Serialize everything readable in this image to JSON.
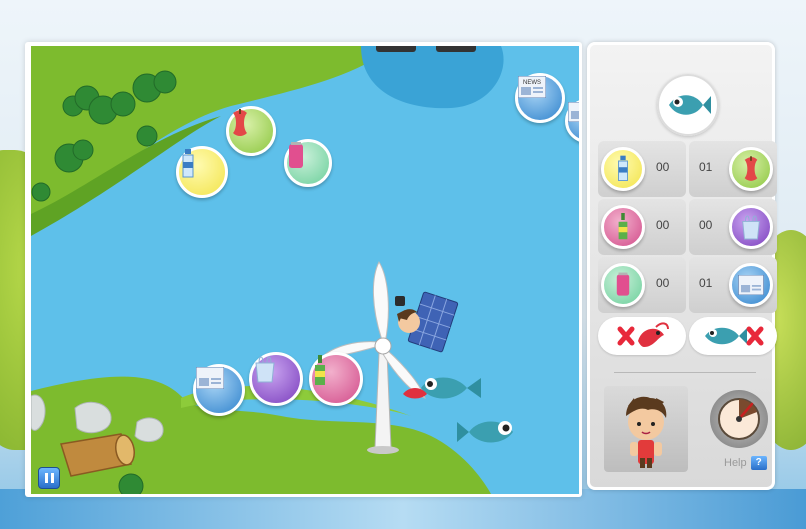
{
  "panel": {
    "rows": [
      {
        "left_count": "00",
        "right_count": "01",
        "left_item": "water-bottle-icon",
        "right_item": "apple-core-icon"
      },
      {
        "left_count": "00",
        "right_count": "00",
        "left_item": "glass-bottle-icon",
        "right_item": "plastic-bag-icon"
      },
      {
        "left_count": "00",
        "right_count": "01",
        "left_item": "soda-can-icon",
        "right_item": "newspaper-icon"
      }
    ],
    "avoid": [
      "shrimp-icon",
      "fish-icon"
    ],
    "target_item": "fish-icon",
    "help_label": "Help",
    "help_icon": "?"
  },
  "tokens": {
    "newspaper_label": "NEWS"
  },
  "colors": {
    "water": "#5ec0ea",
    "grass": "#7dbb2e",
    "accent_blue": "#2a6fc9",
    "avoid_x": "#e8283a"
  }
}
